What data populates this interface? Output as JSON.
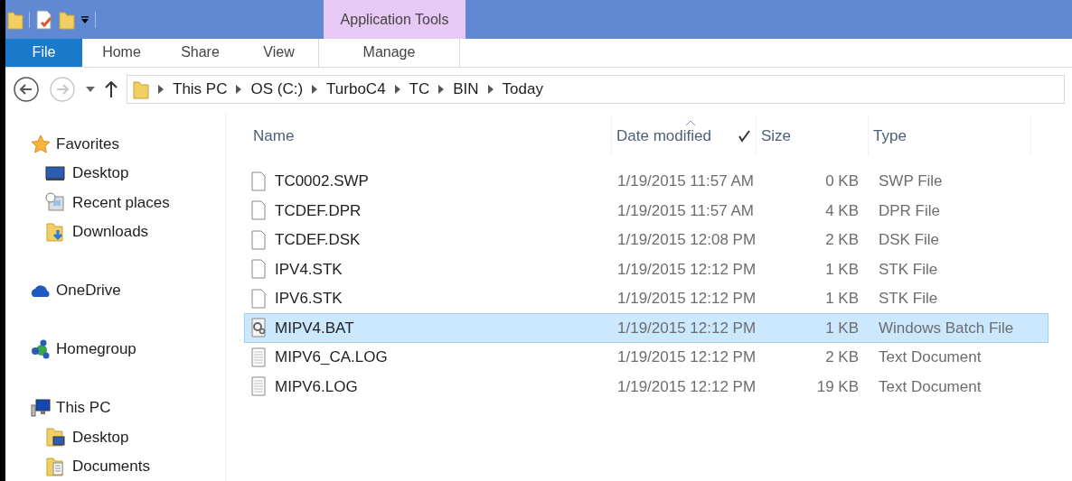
{
  "ribbon": {
    "context_group": "Application Tools",
    "tabs": [
      {
        "label": "File",
        "selected": true,
        "kind": "file"
      },
      {
        "label": "Home",
        "selected": false,
        "kind": "normal"
      },
      {
        "label": "Share",
        "selected": false,
        "kind": "normal"
      },
      {
        "label": "View",
        "selected": false,
        "kind": "normal"
      },
      {
        "label": "Manage",
        "selected": false,
        "kind": "context"
      }
    ]
  },
  "address_bar": {
    "back_disabled": false,
    "forward_disabled": true,
    "breadcrumbs": [
      "This PC",
      "OS (C:)",
      "TurboC4",
      "TC",
      "BIN",
      "Today"
    ]
  },
  "sidebar": {
    "items": [
      {
        "label": "Favorites",
        "children": [
          {
            "label": "Desktop"
          },
          {
            "label": "Recent places"
          },
          {
            "label": "Downloads"
          }
        ]
      },
      {
        "label": "OneDrive"
      },
      {
        "label": "Homegroup"
      },
      {
        "label": "This PC",
        "children": [
          {
            "label": "Desktop"
          },
          {
            "label": "Documents"
          }
        ]
      }
    ]
  },
  "table": {
    "columns": [
      {
        "label": "Name",
        "sorted": false
      },
      {
        "label": "Date modified",
        "sorted": true
      },
      {
        "label": "Size",
        "sorted": false
      },
      {
        "label": "Type",
        "sorted": false
      }
    ],
    "rows": [
      {
        "kind": "file",
        "name": "TC0002.SWP",
        "date": "1/19/2015 11:57 AM",
        "size": "0 KB",
        "type": "SWP File",
        "selected": false
      },
      {
        "kind": "file",
        "name": "TCDEF.DPR",
        "date": "1/19/2015 11:57 AM",
        "size": "4 KB",
        "type": "DPR File",
        "selected": false
      },
      {
        "kind": "file",
        "name": "TCDEF.DSK",
        "date": "1/19/2015 12:08 PM",
        "size": "2 KB",
        "type": "DSK File",
        "selected": false
      },
      {
        "kind": "file",
        "name": "IPV4.STK",
        "date": "1/19/2015 12:12 PM",
        "size": "1 KB",
        "type": "STK File",
        "selected": false
      },
      {
        "kind": "file",
        "name": "IPV6.STK",
        "date": "1/19/2015 12:12 PM",
        "size": "1 KB",
        "type": "STK File",
        "selected": false
      },
      {
        "kind": "batch",
        "name": "MIPV4.BAT",
        "date": "1/19/2015 12:12 PM",
        "size": "1 KB",
        "type": "Windows Batch File",
        "selected": true
      },
      {
        "kind": "text",
        "name": "MIPV6_CA.LOG",
        "date": "1/19/2015 12:12 PM",
        "size": "2 KB",
        "type": "Text Document",
        "selected": false
      },
      {
        "kind": "text",
        "name": "MIPV6.LOG",
        "date": "1/19/2015 12:12 PM",
        "size": "19 KB",
        "type": "Text Document",
        "selected": false
      }
    ]
  }
}
